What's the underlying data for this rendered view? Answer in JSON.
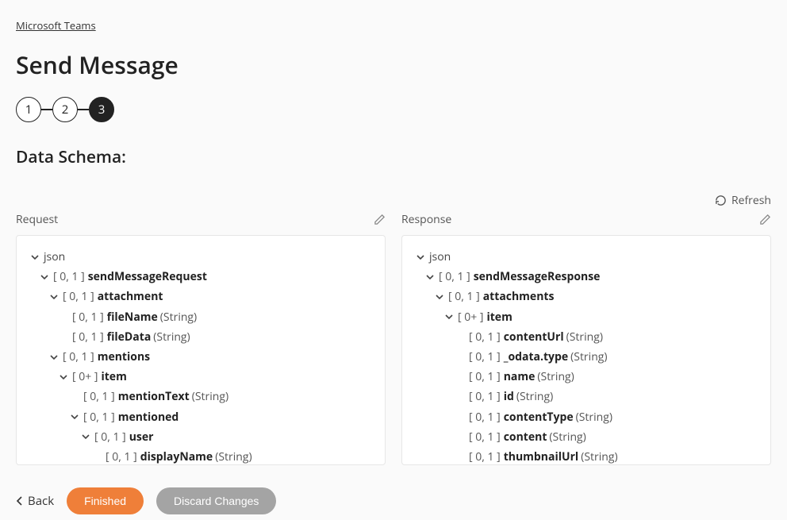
{
  "breadcrumb": "Microsoft Teams",
  "title": "Send Message",
  "stepper": {
    "step1": "1",
    "step2": "2",
    "step3": "3"
  },
  "section": "Data Schema:",
  "labels": {
    "request": "Request",
    "response": "Response",
    "refresh": "Refresh"
  },
  "card": {
    "c01": "[ 0, 1 ]",
    "c0p": "[ 0+ ]"
  },
  "types": {
    "string": "(String)"
  },
  "request": {
    "root": "json",
    "n1": "sendMessageRequest",
    "attachment": "attachment",
    "fileName": "fileName",
    "fileData": "fileData",
    "mentions": "mentions",
    "item": "item",
    "mentionText": "mentionText",
    "mentioned": "mentioned",
    "user": "user",
    "displayName": "displayName"
  },
  "response": {
    "root": "json",
    "n1": "sendMessageResponse",
    "attachments": "attachments",
    "item": "item",
    "contentUrl": "contentUrl",
    "odataType": "_odata.type",
    "name": "name",
    "id": "id",
    "contentType": "contentType",
    "content": "content",
    "thumbnailUrl": "thumbnailUrl"
  },
  "footer": {
    "back": "Back",
    "finished": "Finished",
    "discard": "Discard Changes"
  }
}
